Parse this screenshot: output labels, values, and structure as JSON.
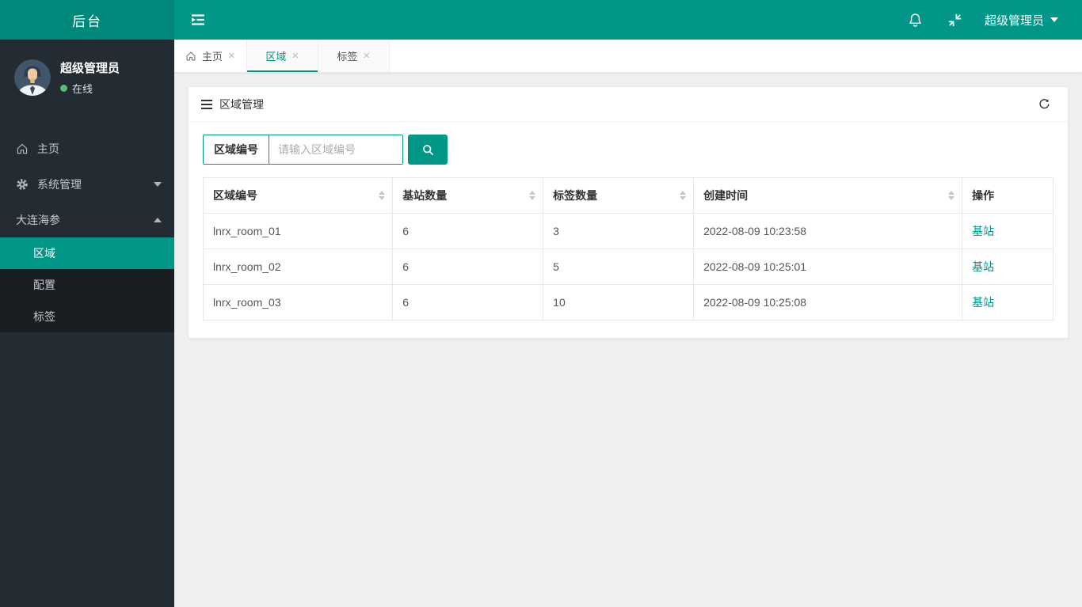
{
  "topbar": {
    "logo_title": "后台",
    "user_menu_label": "超级管理员",
    "icons": [
      "sidebar-toggle-icon",
      "bell-icon",
      "fullscreen-compress-icon",
      "caret-down-icon"
    ]
  },
  "sidebar": {
    "user": {
      "name": "超级管理员",
      "status": "在线",
      "status_color": "#5FB878"
    },
    "menu": [
      {
        "label": "主页",
        "icon": "home-icon"
      },
      {
        "label": "系统管理",
        "icon": "gear-icon",
        "caret": "down"
      },
      {
        "label": "大连海参",
        "caret": "up",
        "children": [
          {
            "label": "区域",
            "active": true
          },
          {
            "label": "配置",
            "active": false
          },
          {
            "label": "标签",
            "active": false
          }
        ]
      }
    ]
  },
  "tabs": [
    {
      "label": "主页",
      "icon": "home-icon",
      "close": "×",
      "active": false
    },
    {
      "label": "区域",
      "close": "×",
      "active": true
    },
    {
      "label": "标签",
      "close": "×",
      "active": false
    }
  ],
  "panel": {
    "title": "区域管理",
    "icons": [
      "list-icon",
      "refresh-icon"
    ],
    "search": {
      "label": "区域编号",
      "placeholder": "请输入区域编号",
      "button_icon": "search-icon"
    },
    "table": {
      "columns": [
        {
          "label": "区域编号",
          "sortable": true
        },
        {
          "label": "基站数量",
          "sortable": true
        },
        {
          "label": "标签数量",
          "sortable": true
        },
        {
          "label": "创建时间",
          "sortable": true
        },
        {
          "label": "操作",
          "sortable": false
        }
      ],
      "rows": [
        {
          "region_id": "lnrx_room_01",
          "base_station_count": "6",
          "tag_count": "3",
          "created_at": "2022-08-09 10:23:58",
          "action": "基站"
        },
        {
          "region_id": "lnrx_room_02",
          "base_station_count": "6",
          "tag_count": "5",
          "created_at": "2022-08-09 10:25:01",
          "action": "基站"
        },
        {
          "region_id": "lnrx_room_03",
          "base_station_count": "6",
          "tag_count": "10",
          "created_at": "2022-08-09 10:25:08",
          "action": "基站"
        }
      ]
    }
  },
  "colors": {
    "accent_teal": "#009688",
    "logo_teal_dark": "#00897b",
    "sidebar_bg": "#232b33",
    "submenu_bg": "#191e23",
    "content_bg": "#efefef",
    "status_green": "#5FB878",
    "link_teal": "#009688"
  }
}
